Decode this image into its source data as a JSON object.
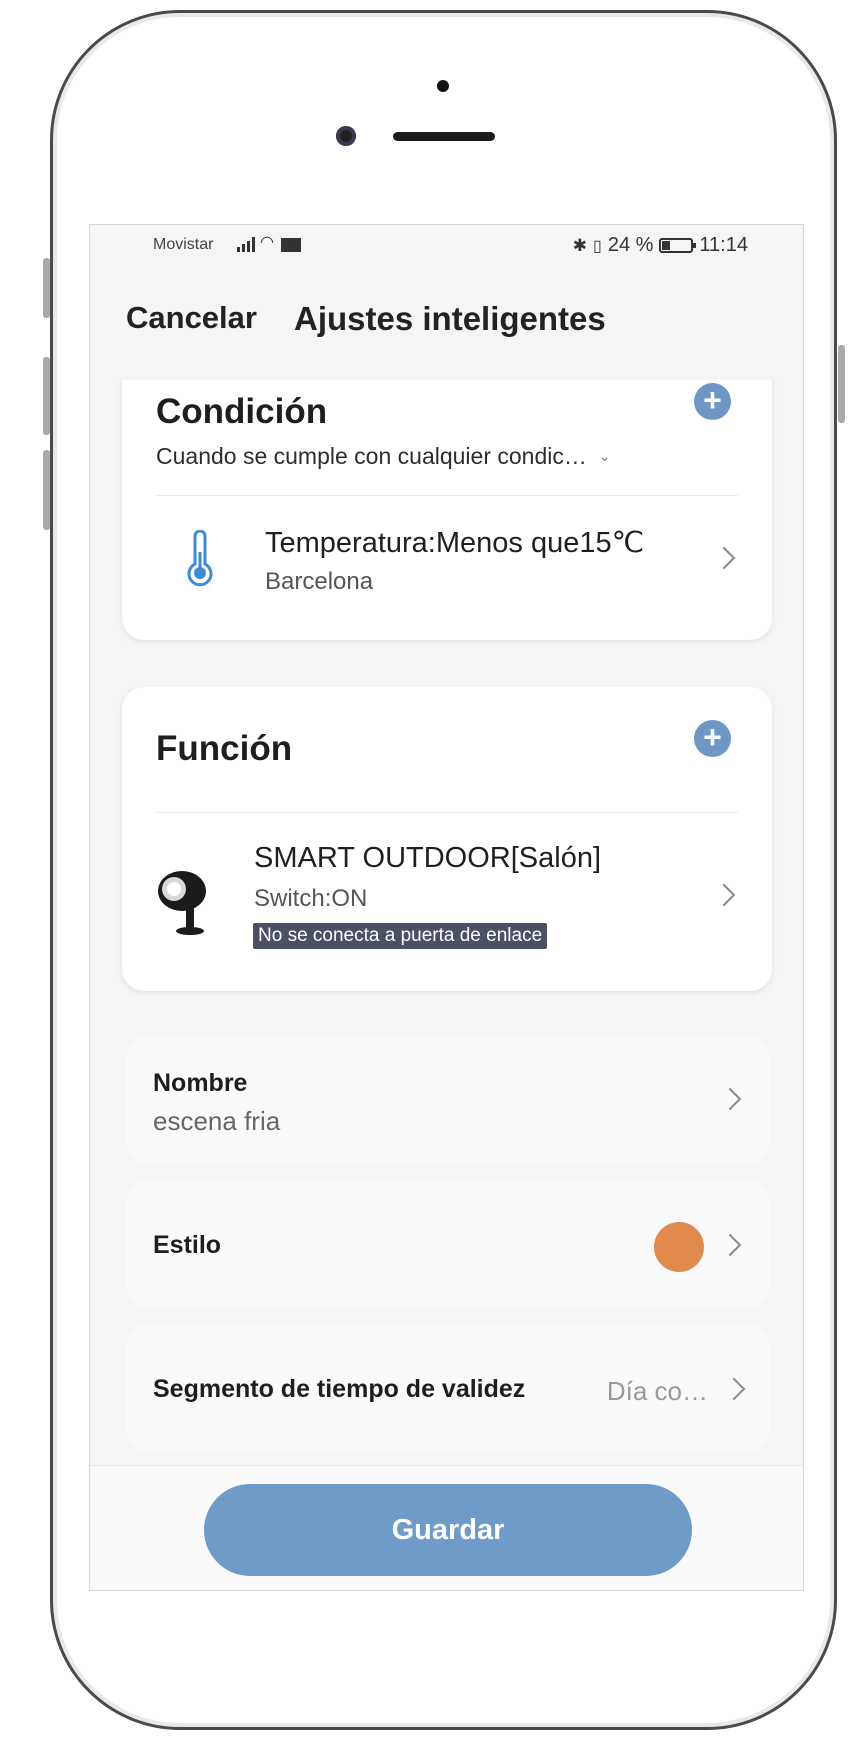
{
  "status_bar": {
    "carrier": "Movistar",
    "signal_icons": [
      "signal-icon",
      "wifi-icon",
      "mail-icon"
    ],
    "right_icons": [
      "bluetooth-icon",
      "vibrate-icon"
    ],
    "battery_text": "24 %",
    "battery_level": 0.24,
    "time": "11:14"
  },
  "nav": {
    "cancel_label": "Cancelar",
    "title": "Ajustes inteligentes"
  },
  "condition": {
    "title": "Condición",
    "mode_label": "Cuando se cumple con cualquier condic…",
    "add_icon": "plus-icon",
    "items": [
      {
        "icon": "thermometer-icon",
        "title": "Temperatura:Menos que15℃",
        "subtitle": "Barcelona"
      }
    ]
  },
  "function": {
    "title": "Función",
    "add_icon": "plus-icon",
    "items": [
      {
        "icon": "outdoor-spotlight-icon",
        "title": "SMART OUTDOOR[Salón]",
        "subtitle": "Switch:ON",
        "warning": "No se conecta a puerta de enlace"
      }
    ]
  },
  "settings": {
    "name": {
      "label": "Nombre",
      "value": "escena fria"
    },
    "style": {
      "label": "Estilo",
      "color": "#E08A4E"
    },
    "validity": {
      "label": "Segmento de tiempo de validez",
      "value": "Día co…"
    }
  },
  "save_label": "Guardar",
  "colors": {
    "accent": "#6F9BC9",
    "plus": "#6F97C5",
    "warning_bg": "#4B5064",
    "thermometer": "#3D8BD6"
  }
}
